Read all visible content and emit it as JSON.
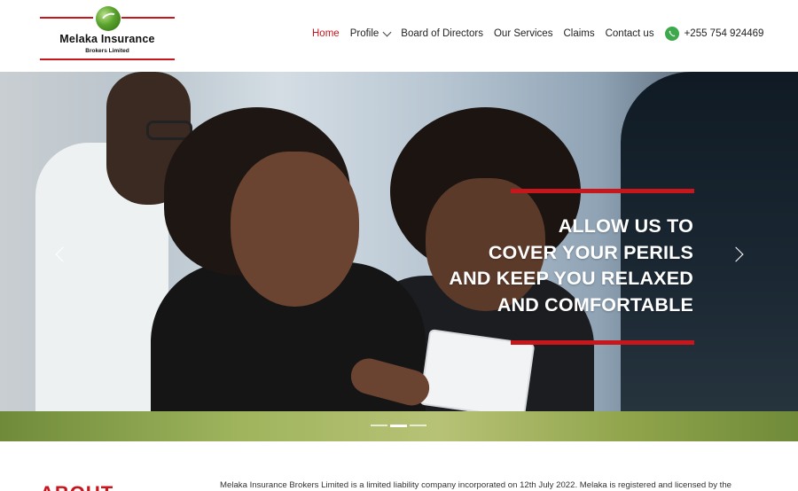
{
  "brand": {
    "name": "Melaka Insurance",
    "subtitle": "Brokers Limited",
    "accent_color": "#c8161d",
    "logo_icon": "green-globe-icon"
  },
  "nav": {
    "items": [
      {
        "label": "Home",
        "active": true
      },
      {
        "label": "Profile",
        "has_dropdown": true
      },
      {
        "label": "Board of Directors"
      },
      {
        "label": "Our Services"
      },
      {
        "label": "Claims"
      },
      {
        "label": "Contact us"
      }
    ],
    "phone": "+255 754 924469",
    "phone_icon": "whatsapp-icon"
  },
  "hero": {
    "lines": [
      "ALLOW US TO",
      "COVER YOUR PERILS",
      "AND KEEP YOU RELAXED",
      "AND COMFORTABLE"
    ],
    "prev_icon": "chevron-left-icon",
    "next_icon": "chevron-right-icon",
    "slides_count": 3,
    "active_slide": 2
  },
  "about": {
    "heading": "ABOUT",
    "text": "Melaka Insurance Brokers Limited is a limited liability company incorporated on 12th July 2022. Melaka is registered and licensed by the"
  }
}
